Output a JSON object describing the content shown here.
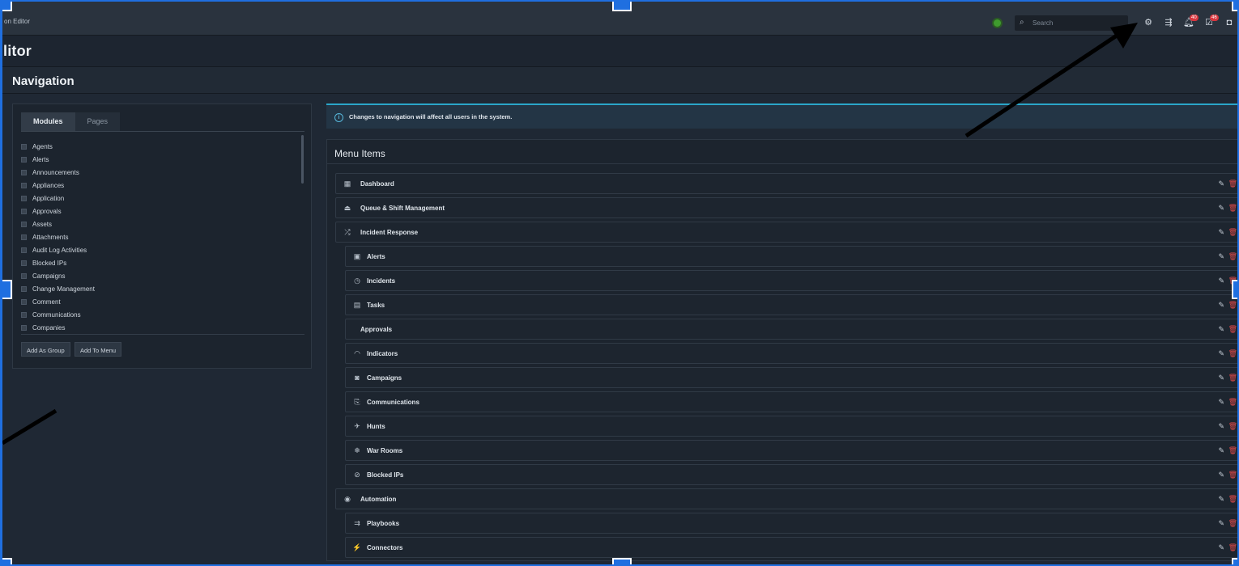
{
  "topbar": {
    "app_title": "on Editor",
    "search_placeholder": "Search",
    "notifications_count": "40",
    "tasks_count": "46"
  },
  "page": {
    "title": "litor",
    "section_title": "Navigation"
  },
  "left_panel": {
    "tabs": [
      "Modules",
      "Pages"
    ],
    "modules": [
      "Agents",
      "Alerts",
      "Announcements",
      "Appliances",
      "Application",
      "Approvals",
      "Assets",
      "Attachments",
      "Audit Log Activities",
      "Blocked IPs",
      "Campaigns",
      "Change Management",
      "Comment",
      "Communications",
      "Companies"
    ],
    "add_group_label": "Add As Group",
    "add_menu_label": "Add To Menu"
  },
  "alert": {
    "message": "Changes to navigation will affect all users in the system."
  },
  "menu": {
    "title": "Menu Items",
    "items": [
      {
        "label": "Dashboard",
        "icon": "grid-icon",
        "glyph": "▦",
        "indent": false
      },
      {
        "label": "Queue & Shift Management",
        "icon": "queue-icon",
        "glyph": "⏏",
        "indent": false
      },
      {
        "label": "Incident Response",
        "icon": "shuffle-icon",
        "glyph": "⤮",
        "indent": false
      },
      {
        "label": "Alerts",
        "icon": "alert-icon",
        "glyph": "▣",
        "indent": true
      },
      {
        "label": "Incidents",
        "icon": "clock-icon",
        "glyph": "◷",
        "indent": true
      },
      {
        "label": "Tasks",
        "icon": "tasks-icon",
        "glyph": "▤",
        "indent": true
      },
      {
        "label": "Approvals",
        "icon": "",
        "glyph": "",
        "indent": true
      },
      {
        "label": "Indicators",
        "icon": "gauge-icon",
        "glyph": "◠",
        "indent": true
      },
      {
        "label": "Campaigns",
        "icon": "campaign-icon",
        "glyph": "◙",
        "indent": true
      },
      {
        "label": "Communications",
        "icon": "communications-icon",
        "glyph": "⎘",
        "indent": true
      },
      {
        "label": "Hunts",
        "icon": "hunt-icon",
        "glyph": "✈",
        "indent": true
      },
      {
        "label": "War Rooms",
        "icon": "war-room-icon",
        "glyph": "❄",
        "indent": true
      },
      {
        "label": "Blocked IPs",
        "icon": "blocked-icon",
        "glyph": "⊘",
        "indent": true
      },
      {
        "label": "Automation",
        "icon": "automation-icon",
        "glyph": "◉",
        "indent": false
      },
      {
        "label": "Playbooks",
        "icon": "playbook-icon",
        "glyph": "⇉",
        "indent": true
      },
      {
        "label": "Connectors",
        "icon": "connector-icon",
        "glyph": "⚡",
        "indent": true
      }
    ]
  },
  "colors": {
    "accent": "#1f6fe0",
    "alert_border": "#2aa6c9",
    "delete": "#e04a4a",
    "status_ok": "#3f9b2e"
  }
}
